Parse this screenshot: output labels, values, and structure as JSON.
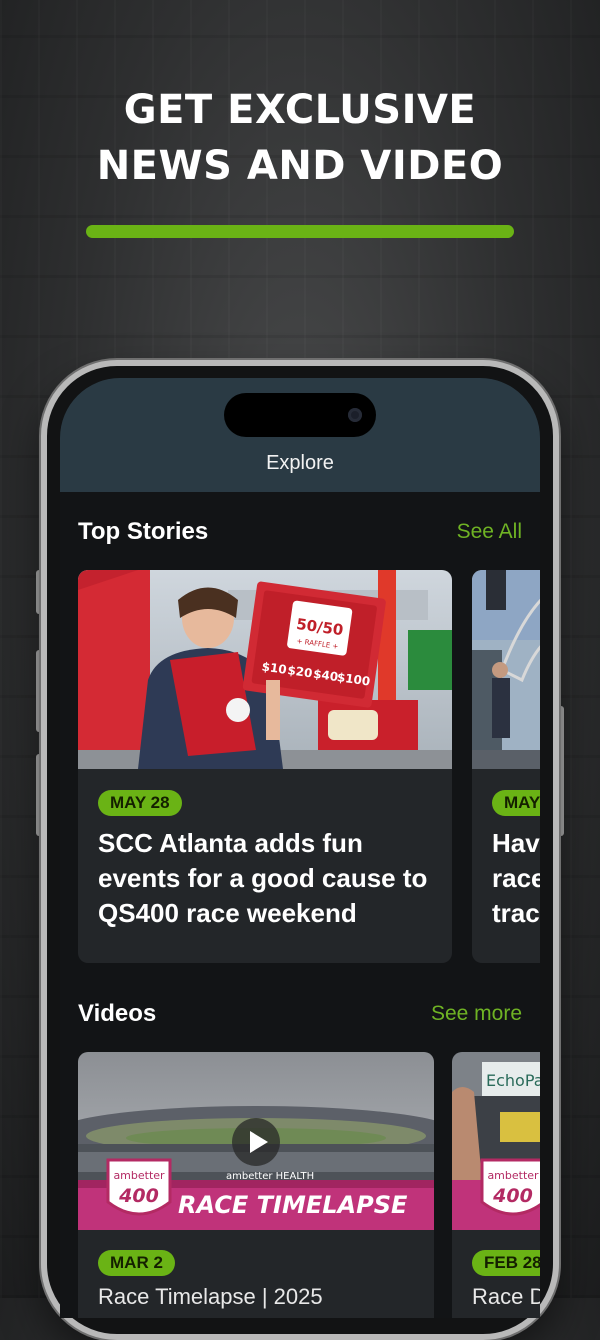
{
  "promo": {
    "headline_line1": "GET EXCLUSIVE",
    "headline_line2": "NEWS AND VIDEO"
  },
  "nav": {
    "title": "Explore"
  },
  "top_stories": {
    "title": "Top Stories",
    "link": "See All",
    "cards": [
      {
        "date": "MAY 28",
        "headline": "SCC Atlanta adds fun events for a good cause to QS400 race weekend",
        "sign_top": "50/50",
        "sign_sub": "+ RAFFLE +",
        "prices": [
          "$10",
          "$20",
          "$40",
          "$100"
        ]
      },
      {
        "date": "MAY",
        "headline_l1": "Hav",
        "headline_l2": "race",
        "headline_l3": "trac"
      }
    ]
  },
  "videos": {
    "title": "Videos",
    "link": "See more",
    "cards": [
      {
        "date": "MAR 2",
        "headline": "Race Timelapse | 2025",
        "banner": "RACE TIMELAPSE",
        "logo_text": "ambetter",
        "logo_num": "400",
        "sponsor": "ambetter HEALTH"
      },
      {
        "date": "FEB 28",
        "headline": "Race D",
        "sign": "EchoPar",
        "logo_text": "ambetter",
        "logo_num": "400"
      }
    ]
  },
  "colors": {
    "accent": "#6ab315",
    "link": "#6fb324",
    "card": "#232629",
    "header": "#2a3a44"
  }
}
